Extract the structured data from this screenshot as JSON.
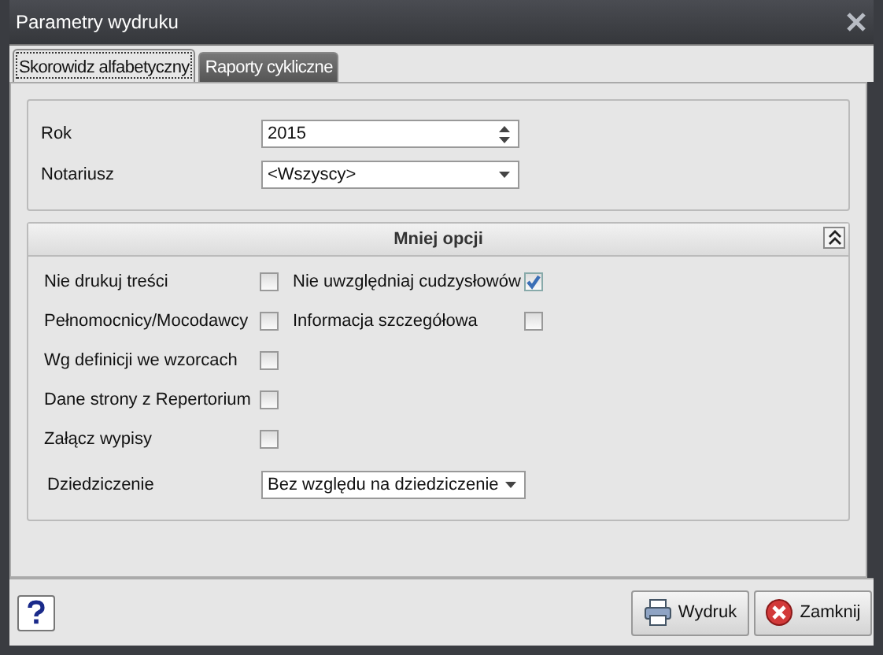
{
  "window": {
    "title": "Parametry wydruku"
  },
  "tabs": [
    {
      "label": "Skorowidz alfabetyczny",
      "selected": true
    },
    {
      "label": "Raporty cykliczne",
      "selected": false
    }
  ],
  "fields": [
    {
      "label": "Rok",
      "kind": "spin",
      "value": "2015"
    },
    {
      "label": "Notariusz",
      "kind": "dropdown",
      "value": "<Wszyscy>"
    }
  ],
  "options": {
    "title": "Mniej opcji",
    "expanded": true,
    "checkboxes": [
      {
        "label": "Nie drukuj treści",
        "checked": false
      },
      {
        "label": "Nie uwzględniaj cudzysłowów",
        "checked": true
      },
      {
        "label": "Pełnomocnicy/Mocodawcy",
        "checked": false
      },
      {
        "label": "Informacja szczegółowa",
        "checked": false
      },
      {
        "label": "Wg definicji we wzorcach",
        "checked": false
      },
      {
        "label": "Dane strony z Repertorium",
        "checked": false
      },
      {
        "label": "Załącz wypisy",
        "checked": false
      }
    ],
    "inheritance": {
      "label": "Dziedziczenie",
      "value": "Bez względu na dziedziczenie"
    }
  },
  "buttons": [
    {
      "label": "Wydruk",
      "kind": "print"
    },
    {
      "label": "Zamknij",
      "kind": "close"
    }
  ]
}
